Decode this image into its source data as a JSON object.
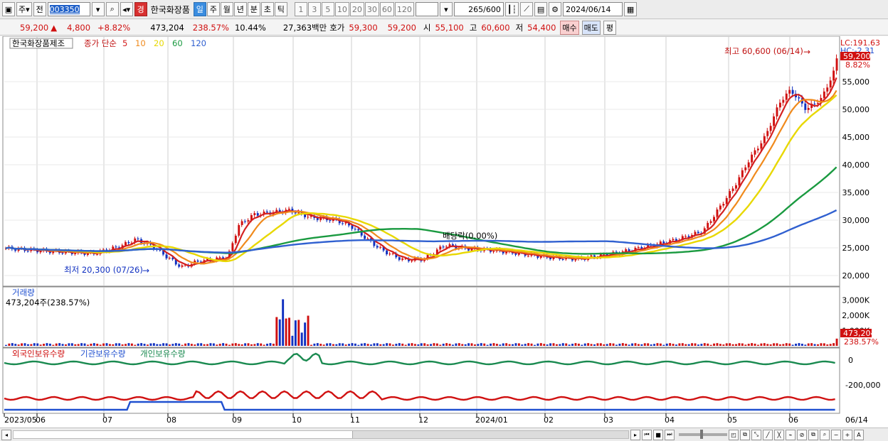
{
  "toolbar": {
    "type_label": "주",
    "prev_label": "전",
    "code": "003350",
    "stock_name": "한국화장품",
    "indicator_badge": "경",
    "periods": [
      "일",
      "주",
      "월",
      "년",
      "분",
      "초",
      "틱"
    ],
    "active_period": "일",
    "intervals": [
      "1",
      "3",
      "5",
      "10",
      "20",
      "30",
      "60",
      "120"
    ],
    "count": "265",
    "count_total": "/600",
    "date": "2024/06/14"
  },
  "quote": {
    "price": "59,200",
    "change": "4,800",
    "change_pct": "+8.82%",
    "volume": "473,204",
    "volume_ratio": "238.57%",
    "turnover": "10.44%",
    "amount": "27,363백만",
    "ask_label": "호가",
    "ask": "59,300",
    "bid": "59,200",
    "open_label": "시",
    "open": "55,100",
    "high_label": "고",
    "high": "60,600",
    "low_label": "저",
    "low": "54,400",
    "buy_label": "매수",
    "sell_label": "매도",
    "eval_label": "평"
  },
  "price_panel": {
    "name": "한국화장품제조",
    "legend_prefix": "종가 단순",
    "ma": [
      {
        "label": "5",
        "color": "#d42020"
      },
      {
        "label": "10",
        "color": "#f08a1c"
      },
      {
        "label": "20",
        "color": "#e8d800"
      },
      {
        "label": "60",
        "color": "#1a9a40"
      },
      {
        "label": "120",
        "color": "#3060d0"
      }
    ],
    "lc": "LC:191.63",
    "hc": "HC:-2.31",
    "current_price": "59,200",
    "current_pct": "8.82%",
    "high_annot": "최고 60,600 (06/14)",
    "low_annot": "최저 20,300 (07/26)",
    "dividend_annot": "배당락(0.00%)",
    "y_ticks": [
      "55,000",
      "50,000",
      "45,000",
      "40,000",
      "35,000",
      "30,000",
      "25,000",
      "20,000"
    ]
  },
  "volume_panel": {
    "title": "거래량",
    "info": "473,204주(238.57%)",
    "y_ticks": [
      "3,000K",
      "2,000K",
      "1,000K"
    ],
    "current": "473,204",
    "current_pct": "238.57%"
  },
  "holding_panel": {
    "legend": [
      {
        "label": "외국인보유수량",
        "color": "#d01010"
      },
      {
        "label": "기관보유수량",
        "color": "#2050d0"
      },
      {
        "label": "개인보유수량",
        "color": "#1a8a50"
      }
    ],
    "y_ticks": [
      "0",
      "-200,000"
    ]
  },
  "x_axis": {
    "labels": [
      "2023/05",
      "06",
      "07",
      "08",
      "09",
      "10",
      "11",
      "12",
      "2024/01",
      "02",
      "03",
      "04",
      "05",
      "06"
    ],
    "end_label": "06/14"
  },
  "colors": {
    "up": "#d01010",
    "down": "#1030c0"
  }
}
